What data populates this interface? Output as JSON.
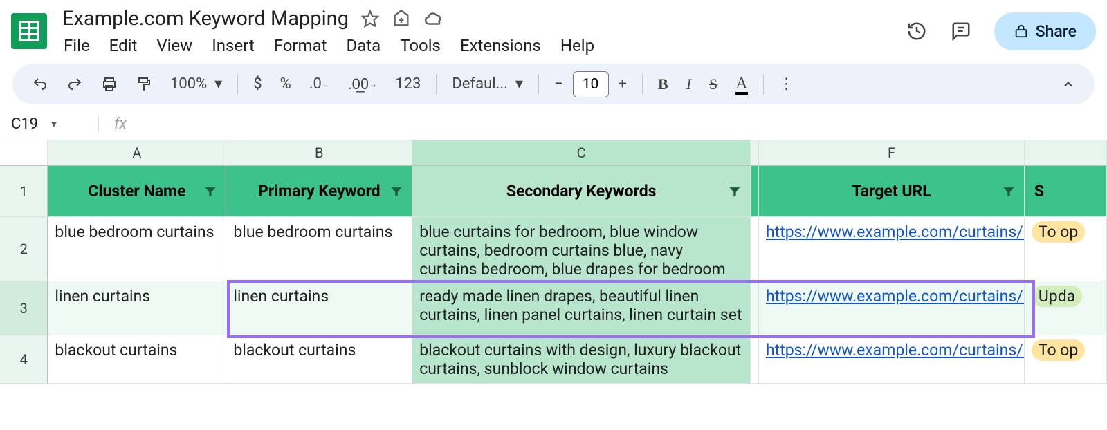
{
  "doc": {
    "title": "Example.com Keyword Mapping"
  },
  "menus": [
    "File",
    "Edit",
    "View",
    "Insert",
    "Format",
    "Data",
    "Tools",
    "Extensions",
    "Help"
  ],
  "share": {
    "label": "Share"
  },
  "toolbar": {
    "zoom": "100%",
    "currency": "$",
    "percent": "%",
    "dec_dec": ".0",
    "inc_dec": ".00",
    "num123": "123",
    "font": "Defaul...",
    "fontSize": "10"
  },
  "namebox": "C19",
  "columns": {
    "A": "A",
    "B": "B",
    "C": "C",
    "F": "F"
  },
  "headers": {
    "A": "Cluster Name",
    "B": "Primary Keyword",
    "C": "Secondary Keywords",
    "F": "Target URL",
    "G": "S"
  },
  "rows": [
    {
      "n": "2",
      "A": "blue bedroom curtains",
      "B": "blue bedroom curtains",
      "C": "blue curtains for bedroom, blue window curtains, bedroom curtains blue, navy curtains bedroom, blue drapes for bedroom",
      "F": "https://www.example.com/curtains/bedroom/blue/",
      "G": "To op"
    },
    {
      "n": "3",
      "A": "linen curtains",
      "B": "linen curtains",
      "C": "ready made linen drapes, beautiful linen curtains, linen panel curtains, linen curtain set",
      "F": "https://www.example.com/curtains/linen/",
      "G": "Upda"
    },
    {
      "n": "4",
      "A": "blackout curtains",
      "B": "blackout curtains",
      "C": "blackout curtains with design, luxury blackout curtains, sunblock window curtains",
      "F": "https://www.example.com/curtains/bedroom/blackout/",
      "G": "To op"
    }
  ]
}
